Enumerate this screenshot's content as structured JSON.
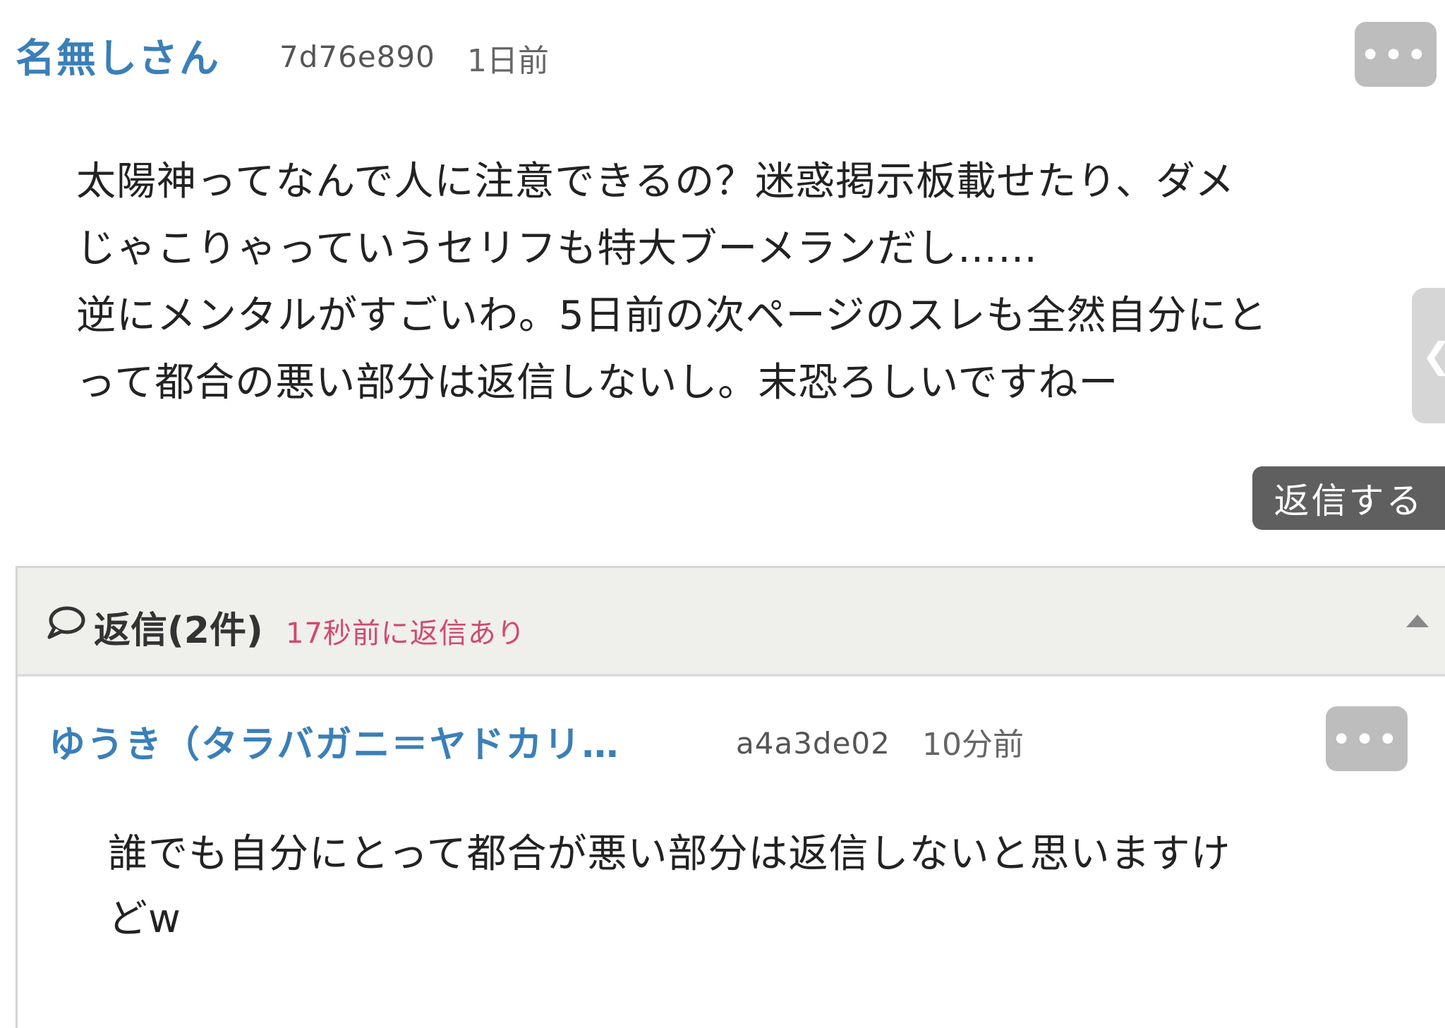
{
  "post": {
    "author": "名無しさん",
    "id": "7d76e890",
    "time": "1日前",
    "more_label": "•••",
    "body_lines": [
      "太陽神ってなんで人に注意できるの？迷惑掲示板載せたり、ダメ",
      "じゃこりゃっていうセリフも特大ブーメランだし……",
      "逆にメンタルがすごいわ。5日前の次ページのスレも全然自分にと",
      "って都合の悪い部分は返信しないし。末恐ろしいですねー"
    ],
    "reply_button": "返信する"
  },
  "side_tab": {
    "icon": "chevron-left-icon",
    "glyph": "❮"
  },
  "replies": {
    "title": "返信(2件)",
    "latest": "17秒前に返信あり",
    "bubble_icon": "speech-bubble-icon",
    "collapse_icon": "caret-up-icon",
    "items": [
      {
        "author": "ゆうき（タラバガニ＝ヤドカリ…",
        "id": "a4a3de02",
        "time": "10分前",
        "more_label": "•••",
        "body_lines": [
          "誰でも自分にとって都合が悪い部分は返信しないと思いますけ",
          "どw"
        ]
      }
    ]
  },
  "colors": {
    "author": "#3b7fb8",
    "latest": "#d04a6e",
    "more_button": "#bdbdbd",
    "reply_button": "#5f5f5f",
    "panel_header": "#efefeb"
  }
}
